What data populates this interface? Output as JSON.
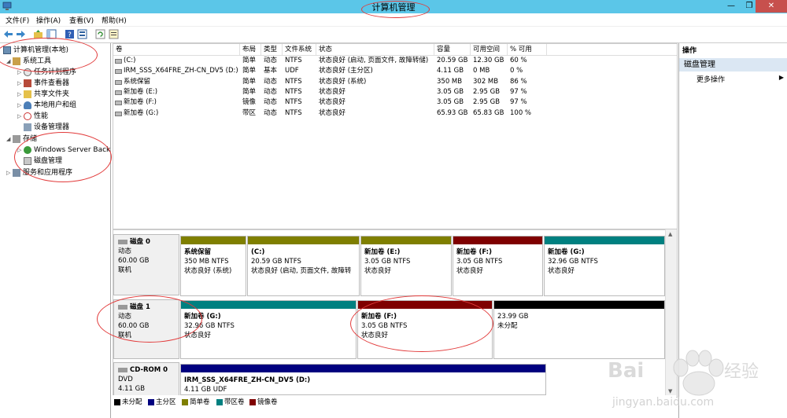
{
  "window": {
    "title": "计算机管理"
  },
  "menu": [
    "文件(F)",
    "操作(A)",
    "查看(V)",
    "帮助(H)"
  ],
  "tree": {
    "root": "计算机管理(本地)",
    "system_tools": "系统工具",
    "task_scheduler": "任务计划程序",
    "event_viewer": "事件查看器",
    "shared_folders": "共享文件夹",
    "local_users": "本地用户和组",
    "performance": "性能",
    "device_manager": "设备管理器",
    "storage": "存储",
    "windows_server_backup": "Windows Server Back",
    "disk_management": "磁盘管理",
    "services_apps": "服务和应用程序"
  },
  "volumes": {
    "headers": [
      "卷",
      "布局",
      "类型",
      "文件系统",
      "状态",
      "容量",
      "可用空间",
      "% 可用"
    ],
    "rows": [
      [
        "(C:)",
        "简单",
        "动态",
        "NTFS",
        "状态良好 (启动, 页面文件, 故障转储)",
        "20.59 GB",
        "12.30 GB",
        "60 %"
      ],
      [
        "IRM_SSS_X64FRE_ZH-CN_DV5 (D:)",
        "简单",
        "基本",
        "UDF",
        "状态良好 (主分区)",
        "4.11 GB",
        "0 MB",
        "0 %"
      ],
      [
        "系统保留",
        "简单",
        "动态",
        "NTFS",
        "状态良好 (系统)",
        "350 MB",
        "302 MB",
        "86 %"
      ],
      [
        "新加卷 (E:)",
        "简单",
        "动态",
        "NTFS",
        "状态良好",
        "3.05 GB",
        "2.95 GB",
        "97 %"
      ],
      [
        "新加卷 (F:)",
        "镜像",
        "动态",
        "NTFS",
        "状态良好",
        "3.05 GB",
        "2.95 GB",
        "97 %"
      ],
      [
        "新加卷 (G:)",
        "带区",
        "动态",
        "NTFS",
        "状态良好",
        "65.93 GB",
        "65.83 GB",
        "100 %"
      ]
    ]
  },
  "disks": {
    "disk0": {
      "name": "磁盘 0",
      "type": "动态",
      "size": "60.00 GB",
      "status": "联机",
      "parts": [
        {
          "name": "系统保留",
          "size": "350 MB NTFS",
          "status": "状态良好 (系统)",
          "color": "#7f7f00"
        },
        {
          "name": "(C:)",
          "size": "20.59 GB NTFS",
          "status": "状态良好 (启动, 页面文件, 故障转",
          "color": "#7f7f00"
        },
        {
          "name": "新加卷 (E:)",
          "size": "3.05 GB NTFS",
          "status": "状态良好",
          "color": "#7f7f00"
        },
        {
          "name": "新加卷 (F:)",
          "size": "3.05 GB NTFS",
          "status": "状态良好",
          "color": "#7f0000"
        },
        {
          "name": "新加卷 (G:)",
          "size": "32.96 GB NTFS",
          "status": "状态良好",
          "color": "#008080"
        }
      ]
    },
    "disk1": {
      "name": "磁盘 1",
      "type": "动态",
      "size": "60.00 GB",
      "status": "联机",
      "parts": [
        {
          "name": "新加卷 (G:)",
          "size": "32.96 GB NTFS",
          "status": "状态良好",
          "color": "#008080"
        },
        {
          "name": "新加卷 (F:)",
          "size": "3.05 GB NTFS",
          "status": "状态良好",
          "color": "#7f0000"
        },
        {
          "name": "",
          "size": "23.99 GB",
          "status": "未分配",
          "color": "#000000"
        }
      ]
    },
    "cdrom0": {
      "name": "CD-ROM 0",
      "type": "DVD",
      "size": "4.11 GB",
      "parts": [
        {
          "name": "IRM_SSS_X64FRE_ZH-CN_DV5 (D:)",
          "size": "4.11 GB UDF",
          "status": "",
          "color": "#00007f"
        }
      ]
    }
  },
  "legend": [
    {
      "label": "未分配",
      "color": "#000000"
    },
    {
      "label": "主分区",
      "color": "#00007f"
    },
    {
      "label": "简单卷",
      "color": "#7f7f00"
    },
    {
      "label": "带区卷",
      "color": "#008080"
    },
    {
      "label": "镜像卷",
      "color": "#7f0000"
    }
  ],
  "actions": {
    "header": "操作",
    "section": "磁盘管理",
    "more": "更多操作"
  },
  "watermark": "Baidu 经验 jingyan.baidu.com"
}
